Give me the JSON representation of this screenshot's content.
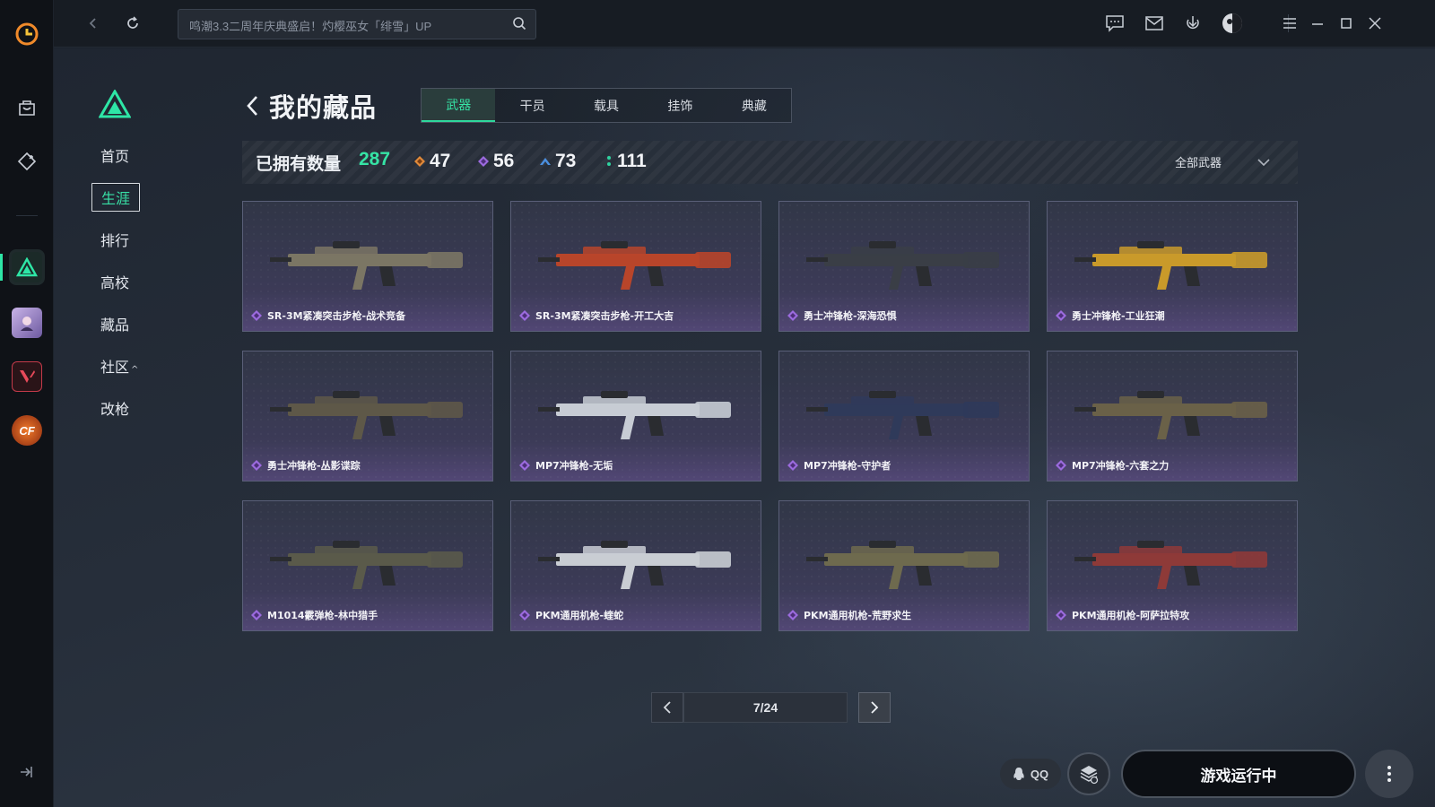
{
  "topbar": {
    "search_placeholder": "鸣潮3.3二周年庆典盛启！灼樱巫女「绯雪」UP"
  },
  "subnav": {
    "items": [
      "首页",
      "生涯",
      "排行",
      "高校",
      "藏品",
      "社区",
      "改枪"
    ],
    "active": "生涯"
  },
  "page": {
    "title": "我的藏品",
    "tabs": [
      "武器",
      "干员",
      "载具",
      "挂饰",
      "典藏"
    ],
    "active_tab": "武器"
  },
  "stats": {
    "label": "已拥有数量",
    "total": "287",
    "rarities": [
      {
        "value": "47",
        "color": "#e08a3a"
      },
      {
        "value": "56",
        "color": "#9b6bde"
      },
      {
        "value": "73",
        "color": "#4a8fe0"
      },
      {
        "value": "111",
        "color": "#2fd3a0"
      }
    ],
    "filter_label": "全部武器"
  },
  "items": [
    {
      "name": "SR-3M紧凑突击步枪-战术竞备",
      "rarity_color": "#9b6bde",
      "gun_color": "#7b7664"
    },
    {
      "name": "SR-3M紧凑突击步枪-开工大吉",
      "rarity_color": "#9b6bde",
      "gun_color": "#b8452a"
    },
    {
      "name": "勇士冲锋枪-深海恐惧",
      "rarity_color": "#9b6bde",
      "gun_color": "#3a3e46"
    },
    {
      "name": "勇士冲锋枪-工业狂潮",
      "rarity_color": "#9b6bde",
      "gun_color": "#c99a2a"
    },
    {
      "name": "勇士冲锋枪-丛影谍踪",
      "rarity_color": "#9b6bde",
      "gun_color": "#5e5848"
    },
    {
      "name": "MP7冲锋枪-无垢",
      "rarity_color": "#9b6bde",
      "gun_color": "#c7ccd4"
    },
    {
      "name": "MP7冲锋枪-守护者",
      "rarity_color": "#9b6bde",
      "gun_color": "#2f3a5a"
    },
    {
      "name": "MP7冲锋枪-六套之力",
      "rarity_color": "#9b6bde",
      "gun_color": "#6a6148"
    },
    {
      "name": "M1014霰弹枪-林中猎手",
      "rarity_color": "#9b6bde",
      "gun_color": "#5a5a4a"
    },
    {
      "name": "PKM通用机枪-蝰蛇",
      "rarity_color": "#9b6bde",
      "gun_color": "#c9cdd3"
    },
    {
      "name": "PKM通用机枪-荒野求生",
      "rarity_color": "#9b6bde",
      "gun_color": "#6e6a4e"
    },
    {
      "name": "PKM通用机枪-阿萨拉特攻",
      "rarity_color": "#9b6bde",
      "gun_color": "#8e3a38"
    }
  ],
  "pagination": {
    "page_text": "7/24"
  },
  "footer": {
    "qq_label": "QQ",
    "run_label": "游戏运行中"
  },
  "rail": {
    "games": [
      "delta-force",
      "character-game",
      "valorant",
      "crossfire"
    ]
  }
}
